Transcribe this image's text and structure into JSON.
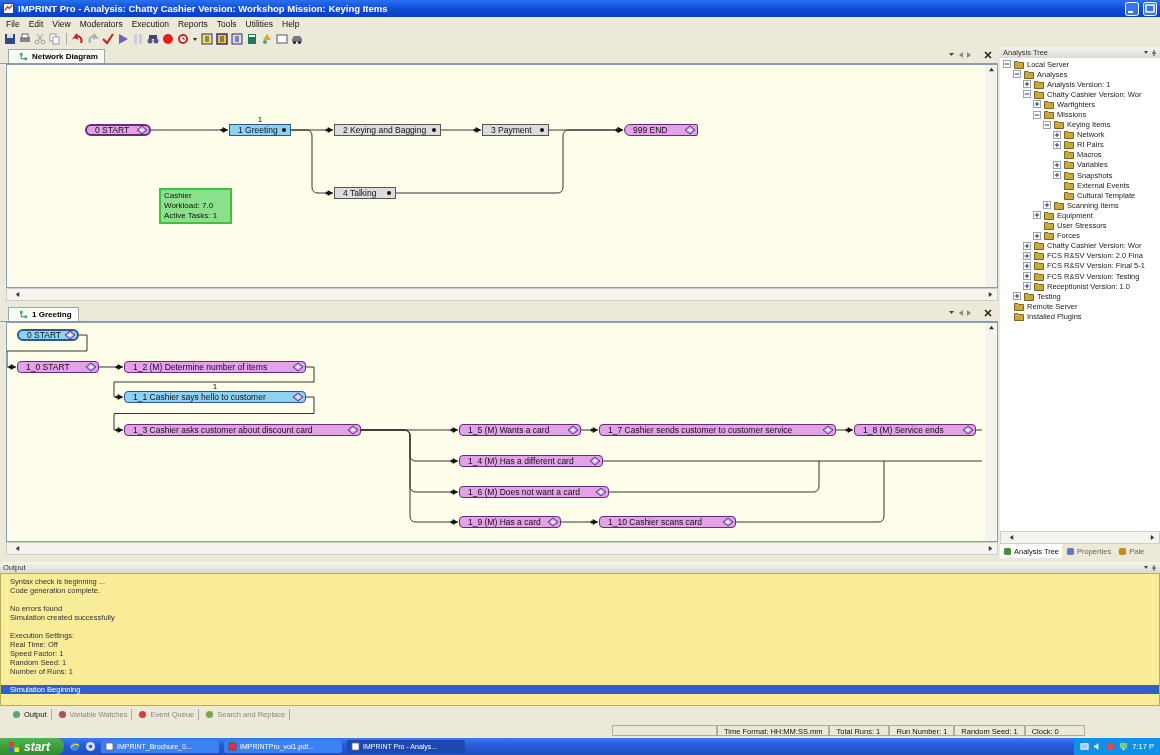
{
  "window": {
    "title": "IMPRINT Pro - Analysis: Chatty Cashier Version: Workshop  Mission: Keying Items"
  },
  "menu": [
    "File",
    "Edit",
    "View",
    "Moderators",
    "Execution",
    "Reports",
    "Tools",
    "Utilities",
    "Help"
  ],
  "network_pane": {
    "tabs": [
      {
        "label": "Network Diagram",
        "selected": true
      }
    ],
    "nodes": [
      {
        "label": "0 START",
        "kind": "start",
        "selected": false
      },
      {
        "label": "1 Greeting",
        "kind": "network",
        "selected": true,
        "badge": "1"
      },
      {
        "label": "2 Keying and Bagging",
        "kind": "network",
        "selected": false
      },
      {
        "label": "3 Payment",
        "kind": "network",
        "selected": false
      },
      {
        "label": "999 END",
        "kind": "end",
        "selected": false
      },
      {
        "label": "4 Talking",
        "kind": "network",
        "selected": false
      }
    ],
    "operator_box": {
      "lines": [
        "Cashier",
        "Workload: 7.0",
        "Active Tasks: 1"
      ]
    }
  },
  "greeting_pane": {
    "tabs": [
      {
        "label": "1 Greeting",
        "selected": true
      }
    ],
    "nodes": [
      {
        "label": "0 START",
        "kind": "start",
        "selected": true
      },
      {
        "label": "1_0 START",
        "kind": "task",
        "selected": false
      },
      {
        "label": "1_2 (M) Determine number of items",
        "kind": "task",
        "selected": false
      },
      {
        "label": "1_1 Cashier says hello to customer",
        "kind": "task",
        "selected": true,
        "badge": "1"
      },
      {
        "label": "1_3 Cashier asks customer about discount card",
        "kind": "task",
        "selected": false
      },
      {
        "label": "1_5 (M) Wants a card",
        "kind": "task",
        "selected": false
      },
      {
        "label": "1_7 Cashier sends customer to customer service",
        "kind": "task",
        "selected": false
      },
      {
        "label": "1_8 (M) Service ends",
        "kind": "task",
        "selected": false,
        "continues": true
      },
      {
        "label": "1_4 (M) Has a different card",
        "kind": "task",
        "selected": false,
        "continues": true
      },
      {
        "label": "1_6 (M) Does not want a card",
        "kind": "task",
        "selected": false,
        "continues": true
      },
      {
        "label": "1_9 (M) Has a card",
        "kind": "task",
        "selected": false
      },
      {
        "label": "1_10 Cashier scans card",
        "kind": "task",
        "selected": false,
        "continues": true
      }
    ]
  },
  "analysis_tree": {
    "title": "Analysis Tree",
    "items": [
      {
        "label": "Local Server",
        "expanded": true,
        "children": [
          {
            "label": "Analyses",
            "expanded": true,
            "children": [
              {
                "label": "Analysis  Version: 1",
                "expanded": false
              },
              {
                "label": "Chatty Cashier  Version: Wor",
                "expanded": true,
                "children": [
                  {
                    "label": "Warfighters",
                    "expanded": false
                  },
                  {
                    "label": "Missions",
                    "expanded": true,
                    "children": [
                      {
                        "label": "Keying Items",
                        "expanded": true,
                        "children": [
                          {
                            "label": "Network",
                            "expanded": false
                          },
                          {
                            "label": "RI Pairs",
                            "expanded": false
                          },
                          {
                            "label": "Macros"
                          },
                          {
                            "label": "Variables",
                            "expanded": false
                          },
                          {
                            "label": "Snapshots",
                            "expanded": false
                          },
                          {
                            "label": "External Events"
                          },
                          {
                            "label": "Cultural Template"
                          }
                        ]
                      },
                      {
                        "label": "Scanning Items",
                        "expanded": false
                      }
                    ]
                  },
                  {
                    "label": "Equipment",
                    "expanded": false
                  },
                  {
                    "label": "User Stressors"
                  },
                  {
                    "label": "Forces",
                    "expanded": false
                  }
                ]
              },
              {
                "label": "Chatty Cashier  Version: Wor",
                "expanded": false
              },
              {
                "label": "FCS R&SV  Version: 2.0 Fina",
                "expanded": false
              },
              {
                "label": "FCS R&SV  Version: Final 5-1",
                "expanded": false
              },
              {
                "label": "FCS R&SV  Version: Testing",
                "expanded": false
              },
              {
                "label": "Receptionist  Version: 1.0",
                "expanded": false
              }
            ]
          },
          {
            "label": "Testing",
            "expanded": false
          }
        ]
      },
      {
        "label": "Remote Server"
      },
      {
        "label": "Installed Plugins"
      }
    ]
  },
  "side_tabs": [
    {
      "label": "Analysis Tree",
      "selected": true
    },
    {
      "label": "Properties",
      "selected": false
    },
    {
      "label": "Pale",
      "selected": false
    }
  ],
  "output": {
    "title": "Output",
    "blocks": [
      {
        "lines": [
          {
            "text": "Syntax check is beginning ...",
            "selected": false
          },
          {
            "text": "Code generation complete.",
            "selected": false
          }
        ]
      },
      {
        "lines": [
          {
            "text": "No errors found",
            "selected": false
          },
          {
            "text": "Simulation created successfully",
            "selected": false
          }
        ]
      },
      {
        "lines": [
          {
            "text": "Execution Settings:",
            "selected": false
          },
          {
            "text": "Real Time: Off",
            "selected": false
          },
          {
            "text": "Speed Factor: 1",
            "selected": false
          },
          {
            "text": "Random Seed: 1",
            "selected": false
          },
          {
            "text": "Number of Runs: 1",
            "selected": false
          }
        ]
      },
      {
        "lines": [
          {
            "text": "Simulation Beginning",
            "selected": true
          }
        ]
      }
    ]
  },
  "output_tabs": [
    {
      "label": "Output",
      "selected": true
    },
    {
      "label": "Variable Watches",
      "selected": false
    },
    {
      "label": "Event Queue",
      "selected": false
    },
    {
      "label": "Search and Replace",
      "selected": false
    }
  ],
  "status_bar": [
    "Time Format: HH:MM:SS.mm",
    "Total Runs: 1",
    "Run Number: 1",
    "Random Seed: 1",
    "Clock: 0"
  ],
  "taskbar": {
    "start": "start",
    "tasks": [
      {
        "label": "IMPRINT_Brochure_0...",
        "selected": false
      },
      {
        "label": "IMPRINTPro_vol1.pdf...",
        "selected": false
      },
      {
        "label": "IMPRINT Pro - Analys...",
        "selected": true
      }
    ],
    "clock": "7:17 P"
  }
}
